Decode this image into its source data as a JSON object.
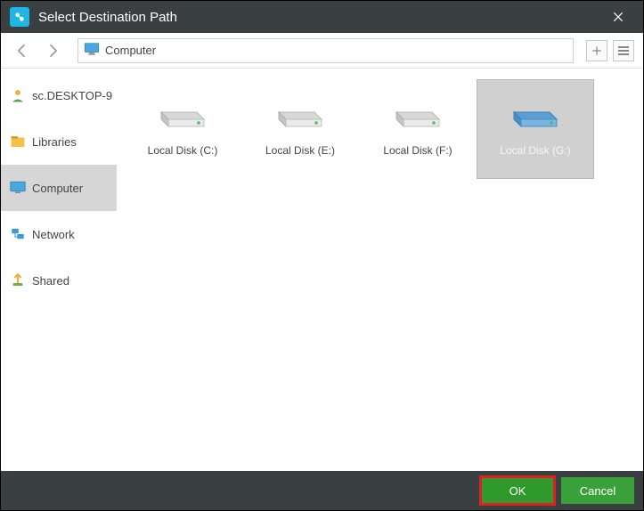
{
  "title": "Select Destination Path",
  "path": "Computer",
  "sidebar": {
    "items": [
      {
        "label": "sc.DESKTOP-9",
        "icon": "user",
        "selected": false
      },
      {
        "label": "Libraries",
        "icon": "libraries",
        "selected": false
      },
      {
        "label": "Computer",
        "icon": "monitor",
        "selected": true
      },
      {
        "label": "Network",
        "icon": "network",
        "selected": false
      },
      {
        "label": "Shared",
        "icon": "shared",
        "selected": false
      }
    ]
  },
  "drives": [
    {
      "label": "Local Disk (C:)",
      "selected": false,
      "color": "gray"
    },
    {
      "label": "Local Disk (E:)",
      "selected": false,
      "color": "gray"
    },
    {
      "label": "Local Disk (F:)",
      "selected": false,
      "color": "gray"
    },
    {
      "label": "Local Disk (G:)",
      "selected": true,
      "color": "blue"
    }
  ],
  "buttons": {
    "ok": "OK",
    "cancel": "Cancel"
  }
}
